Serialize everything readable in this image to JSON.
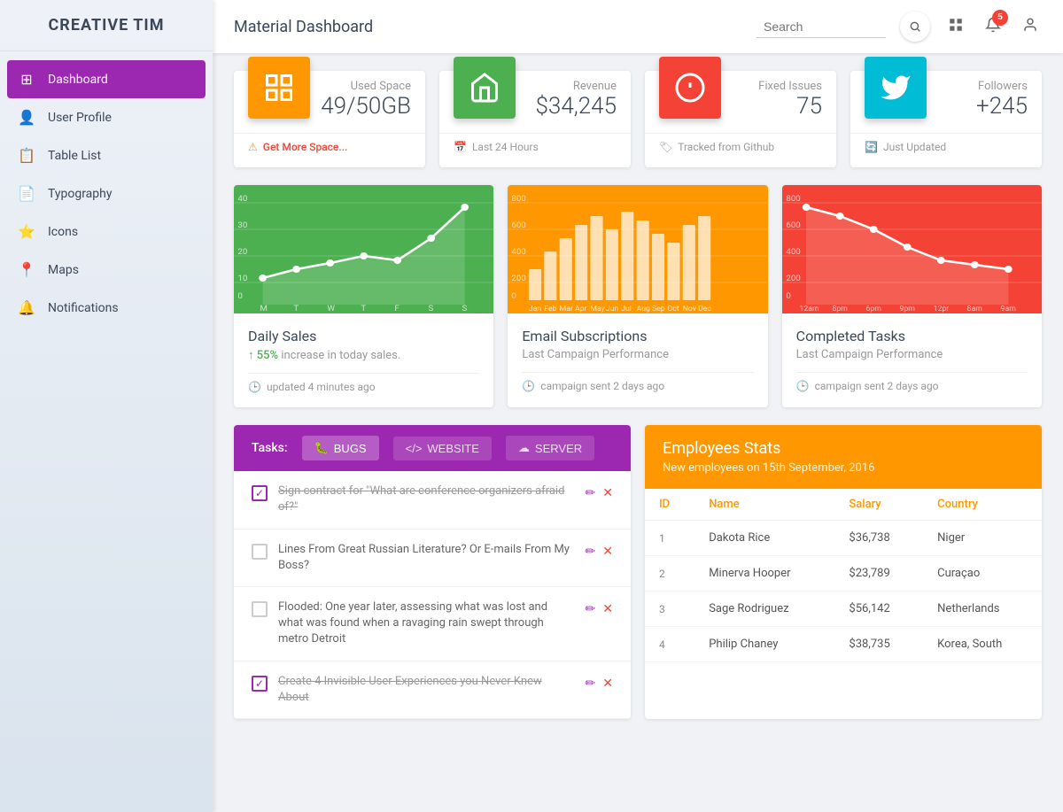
{
  "brand": "CREATIVE TIM",
  "header": {
    "title": "Material Dashboard",
    "search_placeholder": "Search",
    "notifications_count": "5"
  },
  "sidebar": {
    "items": [
      {
        "id": "dashboard",
        "label": "Dashboard",
        "icon": "⊞",
        "active": true
      },
      {
        "id": "user-profile",
        "label": "User Profile",
        "icon": "👤",
        "active": false
      },
      {
        "id": "table-list",
        "label": "Table List",
        "icon": "📋",
        "active": false
      },
      {
        "id": "typography",
        "label": "Typography",
        "icon": "📄",
        "active": false
      },
      {
        "id": "icons",
        "label": "Icons",
        "icon": "⭐",
        "active": false
      },
      {
        "id": "maps",
        "label": "Maps",
        "icon": "📍",
        "active": false
      },
      {
        "id": "notifications",
        "label": "Notifications",
        "icon": "🔔",
        "active": false
      }
    ]
  },
  "stats": [
    {
      "id": "used-space",
      "label": "Used Space",
      "value": "49/50GB",
      "icon": "⧉",
      "icon_bg": "#ff9800",
      "footer": "Get More Space...",
      "footer_icon": "⚠",
      "footer_link": true
    },
    {
      "id": "revenue",
      "label": "Revenue",
      "value": "$34,245",
      "icon": "🏬",
      "icon_bg": "#4caf50",
      "footer": "Last 24 Hours",
      "footer_icon": "📅",
      "footer_link": false
    },
    {
      "id": "fixed-issues",
      "label": "Fixed Issues",
      "value": "75",
      "icon": "ℹ",
      "icon_bg": "#f44336",
      "footer": "Tracked from Github",
      "footer_icon": "🏷",
      "footer_link": false
    },
    {
      "id": "followers",
      "label": "Followers",
      "value": "+245",
      "icon": "🐦",
      "icon_bg": "#00bcd4",
      "footer": "Just Updated",
      "footer_icon": "🔄",
      "footer_link": false
    }
  ],
  "charts": [
    {
      "id": "daily-sales",
      "title": "Daily Sales",
      "subtitle": "55% increase in today sales.",
      "subtitle_highlight": "55%",
      "color": "#4caf50",
      "footer": "updated 4 minutes ago",
      "type": "line"
    },
    {
      "id": "email-subscriptions",
      "title": "Email Subscriptions",
      "subtitle": "Last Campaign Performance",
      "color": "#ff9800",
      "footer": "campaign sent 2 days ago",
      "type": "bar"
    },
    {
      "id": "completed-tasks",
      "title": "Completed Tasks",
      "subtitle": "Last Campaign Performance",
      "color": "#f44336",
      "footer": "campaign sent 2 days ago",
      "type": "line-down"
    }
  ],
  "tasks": {
    "header_label": "Tasks:",
    "tabs": [
      {
        "id": "bugs",
        "label": "BUGS",
        "icon": "🐛",
        "active": true
      },
      {
        "id": "website",
        "label": "WEBSITE",
        "icon": "<>",
        "active": false
      },
      {
        "id": "server",
        "label": "SERVER",
        "icon": "☁",
        "active": false
      }
    ],
    "items": [
      {
        "id": 1,
        "text": "Sign contract for \"What are conference organizers afraid of?\"",
        "done": true
      },
      {
        "id": 2,
        "text": "Lines From Great Russian Literature? Or E-mails From My Boss?",
        "done": false
      },
      {
        "id": 3,
        "text": "Flooded: One year later, assessing what was lost and what was found when a ravaging rain swept through metro Detroit",
        "done": false
      },
      {
        "id": 4,
        "text": "Create 4 Invisible User Experiences you Never Knew About",
        "done": true
      }
    ]
  },
  "employees": {
    "title": "Employees Stats",
    "subtitle": "New employees on 15th September, 2016",
    "columns": [
      "ID",
      "Name",
      "Salary",
      "Country"
    ],
    "rows": [
      {
        "id": "1",
        "name": "Dakota Rice",
        "salary": "$36,738",
        "country": "Niger"
      },
      {
        "id": "2",
        "name": "Minerva Hooper",
        "salary": "$23,789",
        "country": "Curaçao"
      },
      {
        "id": "3",
        "name": "Sage Rodriguez",
        "salary": "$56,142",
        "country": "Netherlands"
      },
      {
        "id": "4",
        "name": "Philip Chaney",
        "salary": "$38,735",
        "country": "Korea, South"
      }
    ]
  }
}
